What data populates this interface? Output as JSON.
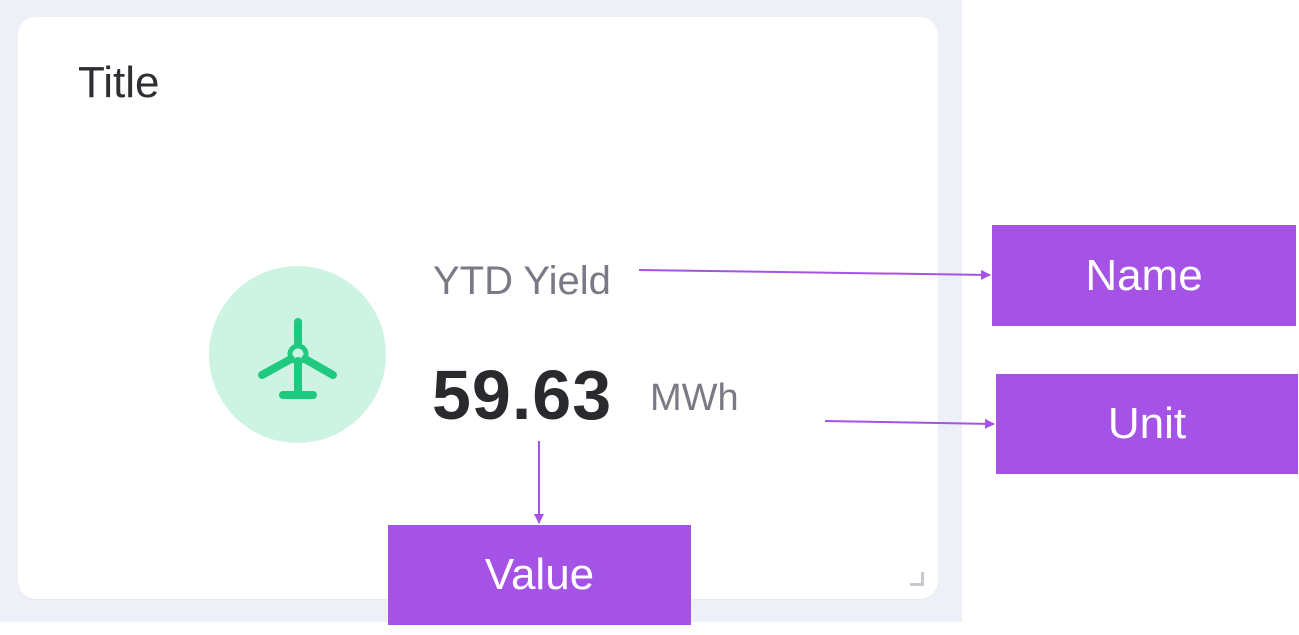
{
  "card": {
    "title": "Title",
    "metric": {
      "name": "YTD Yield",
      "value": "59.63",
      "unit": "MWh",
      "icon": "wind-turbine-icon"
    }
  },
  "callouts": {
    "name": "Name",
    "unit": "Unit",
    "value": "Value"
  },
  "colors": {
    "accent_green": "#1fc97f",
    "icon_bg": "#cdf3e3",
    "callout": "#a553e6",
    "backdrop": "#eef0f7"
  }
}
